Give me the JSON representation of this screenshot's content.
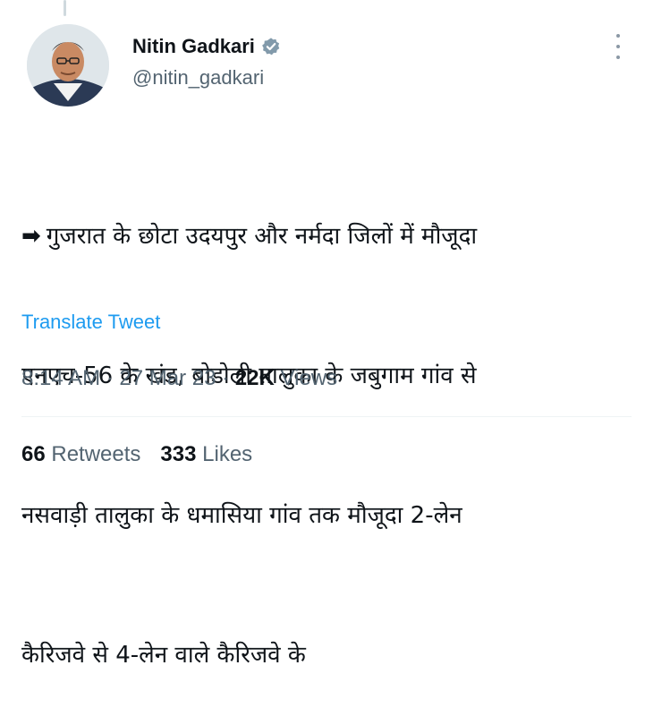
{
  "tweet": {
    "author_name": "Nitin Gadkari",
    "author_handle": "@nitin_gadkari",
    "verified_icon": "verified-badge-icon",
    "avatar_alt": "Nitin Gadkari profile photo",
    "arrow_glyph": "➡",
    "text_lines": [
      "गुजरात के छोटा उदयपुर और नर्मदा जिलों में मौजूदा",
      "एनएच-56 के खंड, बोडोली तालुका के जबुगाम गांव से",
      "नसवाड़ी तालुका के धमासिया गांव तक मौजूदा 2-लेन",
      "कैरिजवे से 4-लेन वाले कैरिजवे के"
    ],
    "translate_label": "Translate Tweet",
    "time": "8:14 AM",
    "date": "27 Mar 23",
    "views_count": "22K",
    "views_label": "Views",
    "retweets_count": "66",
    "retweets_label": "Retweets",
    "likes_count": "333",
    "likes_label": "Likes"
  },
  "colors": {
    "text": "#0f1419",
    "secondary": "#536471",
    "link": "#1d9bf0",
    "verified": "#829aab",
    "divider": "#eff3f4"
  }
}
